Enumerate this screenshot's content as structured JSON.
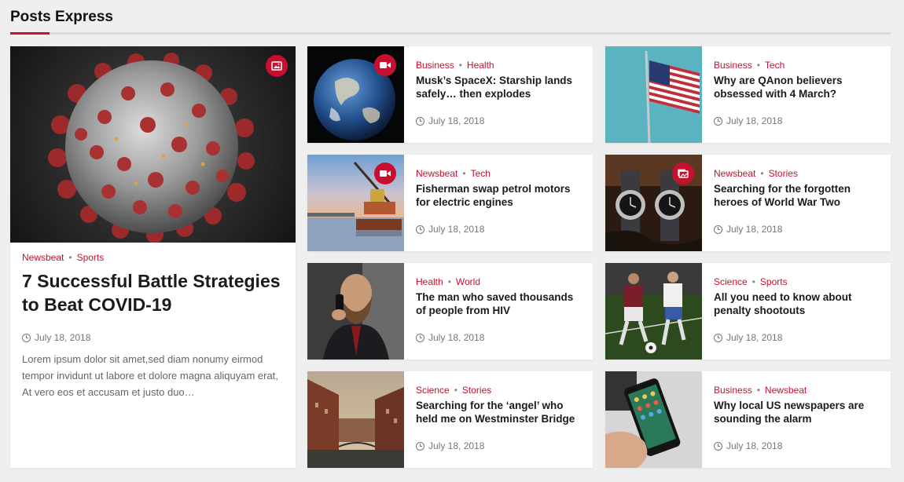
{
  "section": {
    "title": "Posts Express"
  },
  "colors": {
    "accent": "#c8102e",
    "background": "#efefef",
    "card": "#ffffff"
  },
  "featured": {
    "categories": [
      "Newsbeat",
      "Sports"
    ],
    "title": "7 Successful Battle Strategies to Beat COVID-19",
    "date": "July 18, 2018",
    "excerpt": "Lorem ipsum dolor sit amet,sed diam nonumy eirmod tempor invidunt ut labore et dolore magna aliquyam erat, At vero eos et accusam et justo duo…",
    "badge_icon": "image-icon",
    "thumb": "coronavirus-image"
  },
  "posts": [
    {
      "categories": [
        "Business",
        "Health"
      ],
      "title": "Musk’s SpaceX: Starship lands safely… then explodes",
      "date": "July 18, 2018",
      "badge_icon": "video-icon",
      "thumb": "earth-image"
    },
    {
      "categories": [
        "Business",
        "Tech"
      ],
      "title": "Why are QAnon believers obsessed with 4 March?",
      "date": "July 18, 2018",
      "badge_icon": "",
      "thumb": "flag-image"
    },
    {
      "categories": [
        "Newsbeat",
        "Tech"
      ],
      "title": "Fisherman swap petrol motors for electric engines",
      "date": "July 18, 2018",
      "badge_icon": "video-icon",
      "thumb": "harbor-image"
    },
    {
      "categories": [
        "Newsbeat",
        "Stories"
      ],
      "title": "Searching for the forgotten heroes of World War Two",
      "date": "July 18, 2018",
      "badge_icon": "gallery-icon",
      "thumb": "watches-image"
    },
    {
      "categories": [
        "Health",
        "World"
      ],
      "title": "The man who saved thousands of people from HIV",
      "date": "July 18, 2018",
      "badge_icon": "",
      "thumb": "bearded-man-image"
    },
    {
      "categories": [
        "Science",
        "Sports"
      ],
      "title": "All you need to know about penalty shootouts",
      "date": "July 18, 2018",
      "badge_icon": "",
      "thumb": "football-image"
    },
    {
      "categories": [
        "Science",
        "Stories"
      ],
      "title": "Searching for the ‘angel’ who held me on Westminster Bridge",
      "date": "July 18, 2018",
      "badge_icon": "",
      "thumb": "canal-city-image"
    },
    {
      "categories": [
        "Business",
        "Newsbeat"
      ],
      "title": "Why local US newspapers are sounding the alarm",
      "date": "July 18, 2018",
      "badge_icon": "",
      "thumb": "smartphone-image"
    }
  ]
}
